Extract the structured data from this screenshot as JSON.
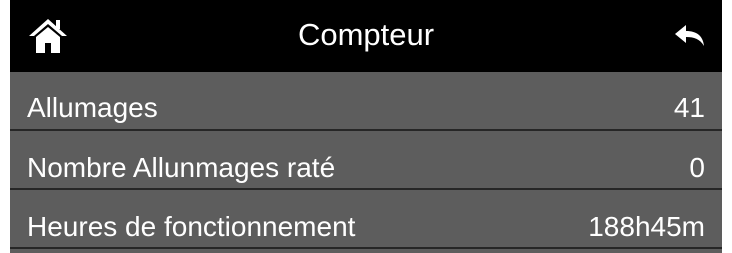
{
  "header": {
    "title": "Compteur",
    "home_icon": "home-icon",
    "back_icon": "back-arrow-icon"
  },
  "counters": [
    {
      "label": "Allumages",
      "value": "41"
    },
    {
      "label": "Nombre Allunmages raté",
      "value": "0"
    },
    {
      "label": "Heures de fonctionnement",
      "value": "188h45m"
    }
  ],
  "colors": {
    "header_bg": "#000000",
    "row_bg": "#5d5d5d",
    "divider": "#262626",
    "text": "#ffffff"
  }
}
